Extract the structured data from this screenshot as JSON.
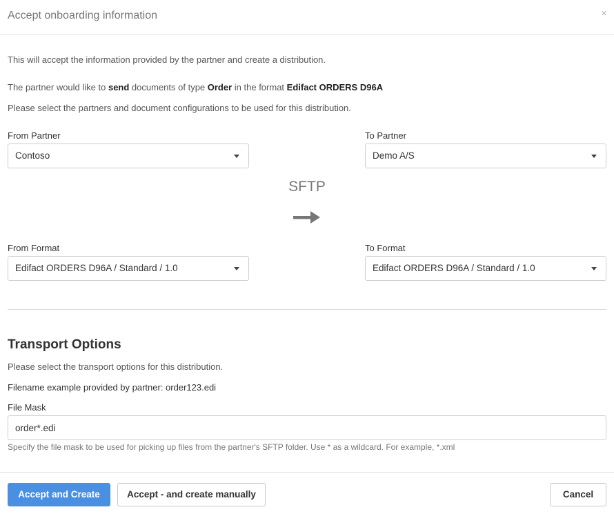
{
  "dialog": {
    "title": "Accept onboarding information",
    "close_icon": "×"
  },
  "intro": {
    "line1": "This will accept the information provided by the partner and create a distribution.",
    "line2_prefix": "The partner would like to ",
    "line2_action": "send",
    "line2_mid": " documents of type ",
    "line2_doctype": "Order",
    "line2_mid2": " in the format ",
    "line2_format": "Edifact ORDERS D96A",
    "line3": "Please select the partners and document configurations to be used for this distribution."
  },
  "from_partner": {
    "label": "From Partner",
    "value": "Contoso"
  },
  "to_partner": {
    "label": "To Partner",
    "value": "Demo A/S"
  },
  "protocol": {
    "label": "SFTP",
    "icon": "arrow-right-icon"
  },
  "from_format": {
    "label": "From Format",
    "value": "Edifact ORDERS D96A / Standard / 1.0"
  },
  "to_format": {
    "label": "To Format",
    "value": "Edifact ORDERS D96A / Standard / 1.0"
  },
  "transport": {
    "title": "Transport Options",
    "description": "Please select the transport options for this distribution.",
    "filename_example": "Filename example provided by partner: order123.edi",
    "file_mask_label": "File Mask",
    "file_mask_value": "order*.edi",
    "file_mask_help": "Specify the file mask to be used for picking up files from the partner's SFTP folder. Use * as a wildcard. For example, *.xml"
  },
  "footer": {
    "accept_create": "Accept and Create",
    "accept_manual": "Accept - and create manually",
    "cancel": "Cancel"
  },
  "colors": {
    "primary": "#4a90e2",
    "arrow": "#777777"
  }
}
